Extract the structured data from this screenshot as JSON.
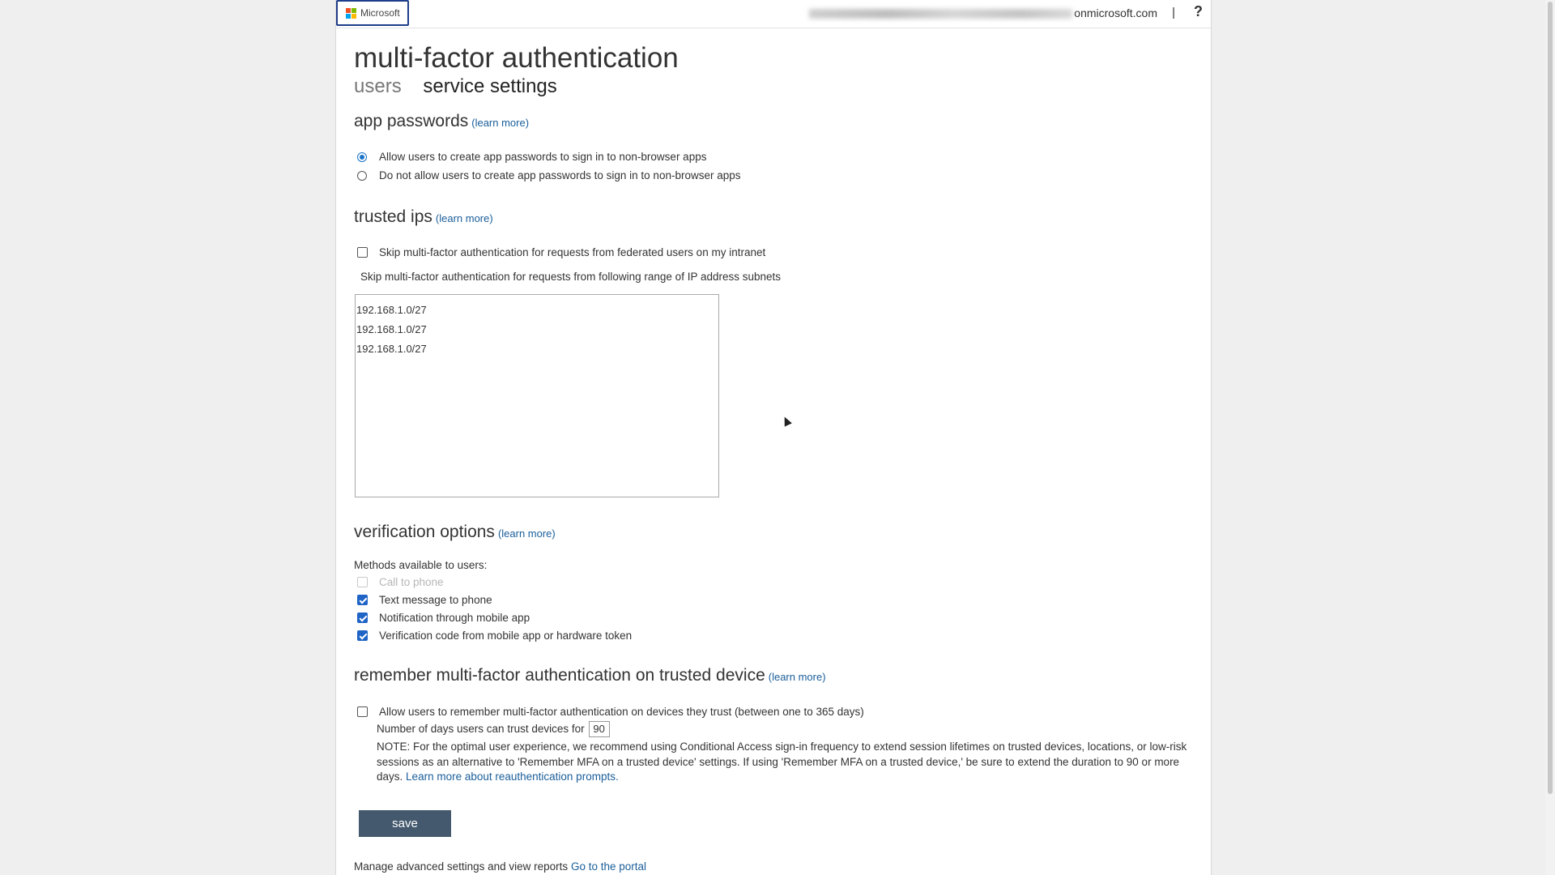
{
  "header": {
    "logo_text": "Microsoft",
    "account_visible": "onmicrosoft.com",
    "separator": "|",
    "help": "?"
  },
  "page_title": "multi-factor authentication",
  "tabs": [
    {
      "label": "users",
      "active": false
    },
    {
      "label": "service settings",
      "active": true
    }
  ],
  "learn_more": "(learn more)",
  "app_passwords": {
    "heading": "app passwords",
    "options": [
      {
        "label": "Allow users to create app passwords to sign in to non-browser apps",
        "selected": true
      },
      {
        "label": "Do not allow users to create app passwords to sign in to non-browser apps",
        "selected": false
      }
    ]
  },
  "trusted_ips": {
    "heading": "trusted ips",
    "skip_federated_label": "Skip multi-factor authentication for requests from federated users on my intranet",
    "skip_federated_checked": false,
    "subnets_label": "Skip multi-factor authentication for requests from following range of IP address subnets",
    "subnets": [
      "192.168.1.0/27",
      "192.168.1.0/27",
      "192.168.1.0/27"
    ]
  },
  "verification_options": {
    "heading": "verification options",
    "methods_label": "Methods available to users:",
    "methods": [
      {
        "label": "Call to phone",
        "checked": false,
        "disabled": true
      },
      {
        "label": "Text message to phone",
        "checked": true,
        "disabled": false
      },
      {
        "label": "Notification through mobile app",
        "checked": true,
        "disabled": false
      },
      {
        "label": "Verification code from mobile app or hardware token",
        "checked": true,
        "disabled": false
      }
    ]
  },
  "remember_mfa": {
    "heading": "remember multi-factor authentication on trusted device",
    "allow_label": "Allow users to remember multi-factor authentication on devices they trust (between one to 365 days)",
    "allow_checked": false,
    "days_label": "Number of days users can trust devices for",
    "days_value": "90",
    "note_text": "NOTE: For the optimal user experience, we recommend using Conditional Access sign-in frequency to extend session lifetimes on trusted devices, locations, or low-risk sessions as an alternative to 'Remember MFA on a trusted device' settings. If using 'Remember MFA on a trusted device,' be sure to extend the duration to 90 or more days.",
    "note_link": "Learn more about reauthentication prompts."
  },
  "save_label": "save",
  "footer": {
    "text": "Manage advanced settings and view reports",
    "link": "Go to the portal"
  },
  "colors": {
    "accent_link": "#1a5e9a",
    "checkbox_blue": "#1f64c6",
    "save_button": "#44596e",
    "logo_border": "#1f3d8a"
  }
}
